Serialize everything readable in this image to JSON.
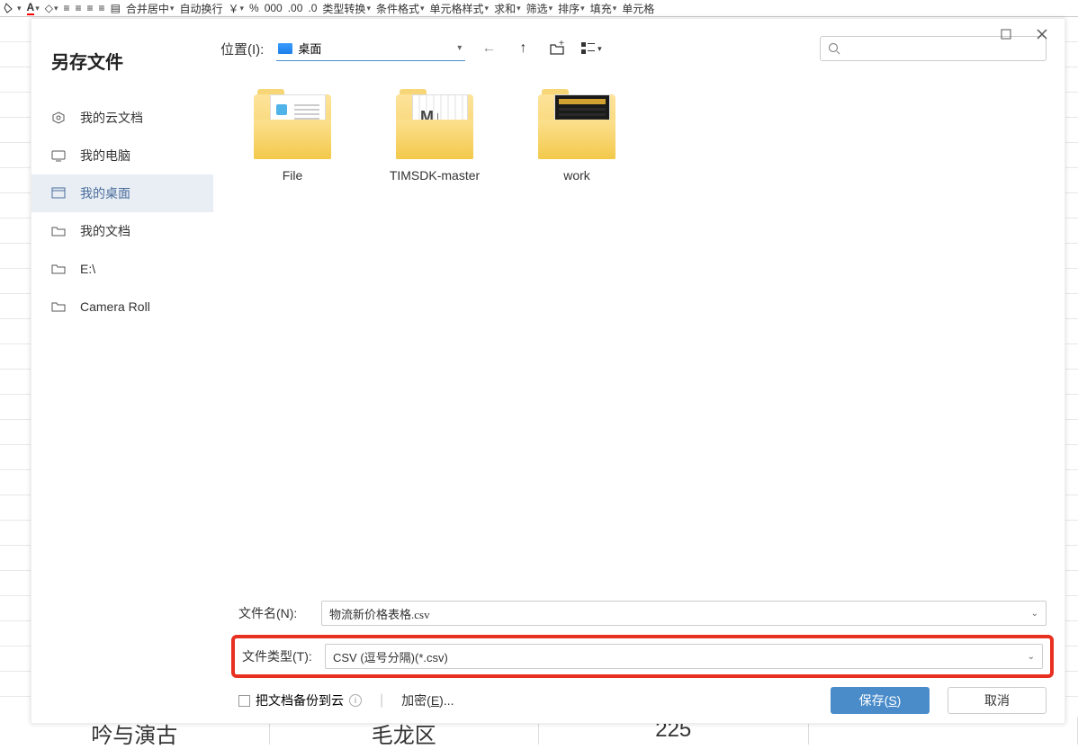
{
  "toolbar": {
    "items": [
      "合并居中",
      "自动换行",
      "￥",
      "%",
      "类型转换",
      "条件格式",
      "单元格样式",
      "求和",
      "筛选",
      "排序",
      "填充",
      "单元格"
    ]
  },
  "dialog": {
    "title": "另存文件",
    "sidebar": [
      {
        "label": "我的云文档"
      },
      {
        "label": "我的电脑"
      },
      {
        "label": "我的桌面"
      },
      {
        "label": "我的文档"
      },
      {
        "label": "E:\\"
      },
      {
        "label": "Camera Roll"
      }
    ],
    "location": {
      "label": "位置(I):",
      "value": "桌面"
    },
    "folders": [
      {
        "name": "File"
      },
      {
        "name": "TIMSDK-master"
      },
      {
        "name": "work"
      }
    ],
    "filename_label": "文件名(N):",
    "filename_value": "物流新价格表格.csv",
    "filetype_label": "文件类型(T):",
    "filetype_value": "CSV (逗号分隔)(*.csv)",
    "backup_label": "把文档备份到云",
    "encrypt_label": "加密(E)...",
    "save_label": "保存(S)",
    "cancel_label": "取消",
    "search_placeholder": ""
  },
  "bg_cells": [
    "吟与演古",
    "毛龙区",
    "225"
  ]
}
